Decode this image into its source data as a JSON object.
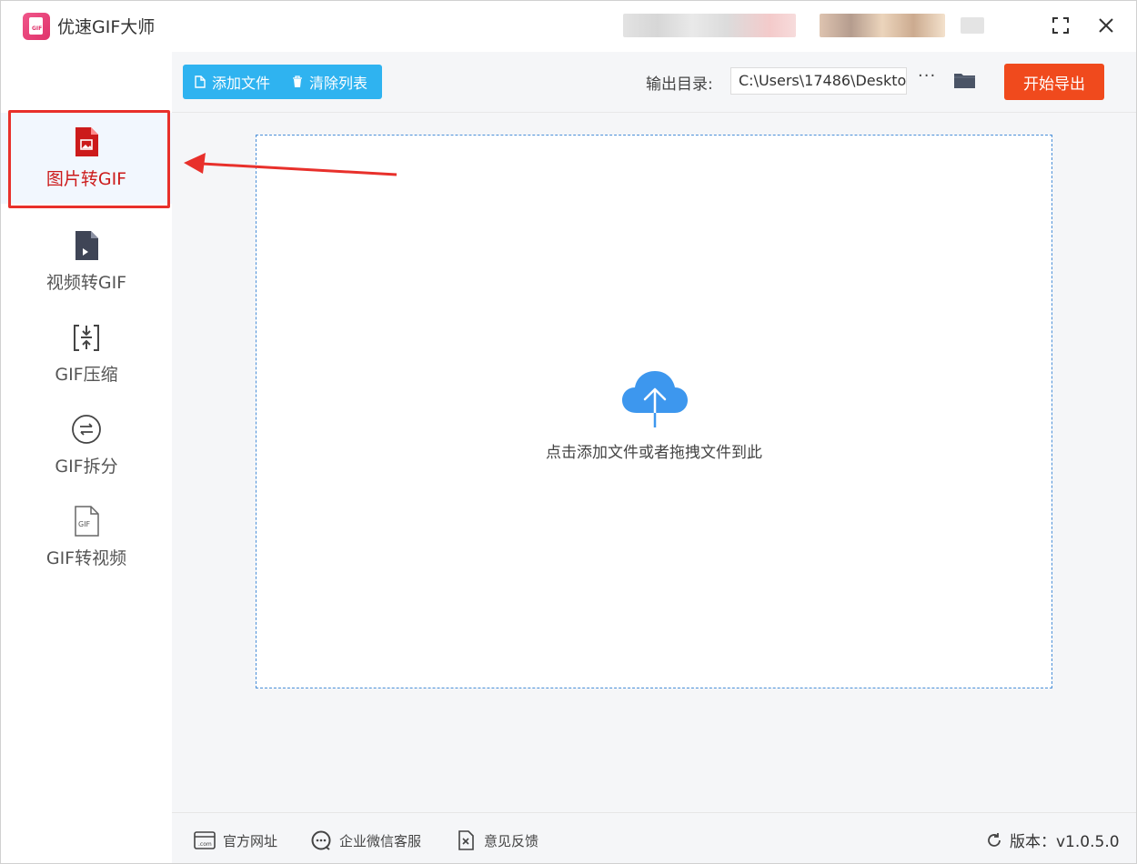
{
  "app": {
    "title": "优速GIF大师",
    "logo_text": "GIF"
  },
  "window_controls": {
    "minimize": "–",
    "maximize": "⛶",
    "close": "✕"
  },
  "sidebar": {
    "items": [
      {
        "label": "图片转GIF",
        "icon": "image-file-icon",
        "active": true
      },
      {
        "label": "视频转GIF",
        "icon": "video-file-icon",
        "active": false
      },
      {
        "label": "GIF压缩",
        "icon": "compress-icon",
        "active": false
      },
      {
        "label": "GIF拆分",
        "icon": "split-icon",
        "active": false
      },
      {
        "label": "GIF转视频",
        "icon": "gif-file-icon",
        "active": false
      }
    ]
  },
  "toolbar": {
    "add_file": "添加文件",
    "clear_list": "清除列表",
    "output_label": "输出目录:",
    "output_path": "C:\\Users\\17486\\Deskto",
    "more": "···",
    "export": "开始导出"
  },
  "dropzone": {
    "text": "点击添加文件或者拖拽文件到此"
  },
  "footer": {
    "website": "官方网址",
    "wechat": "企业微信客服",
    "feedback": "意见反馈",
    "version": "版本：v1.0.5.0"
  },
  "colors": {
    "accent_blue": "#2fb3f0",
    "export_orange": "#f04a1d",
    "highlight_red": "#e8302b",
    "active_label": "#cc1b1b",
    "cloud_blue": "#3d97ee"
  }
}
